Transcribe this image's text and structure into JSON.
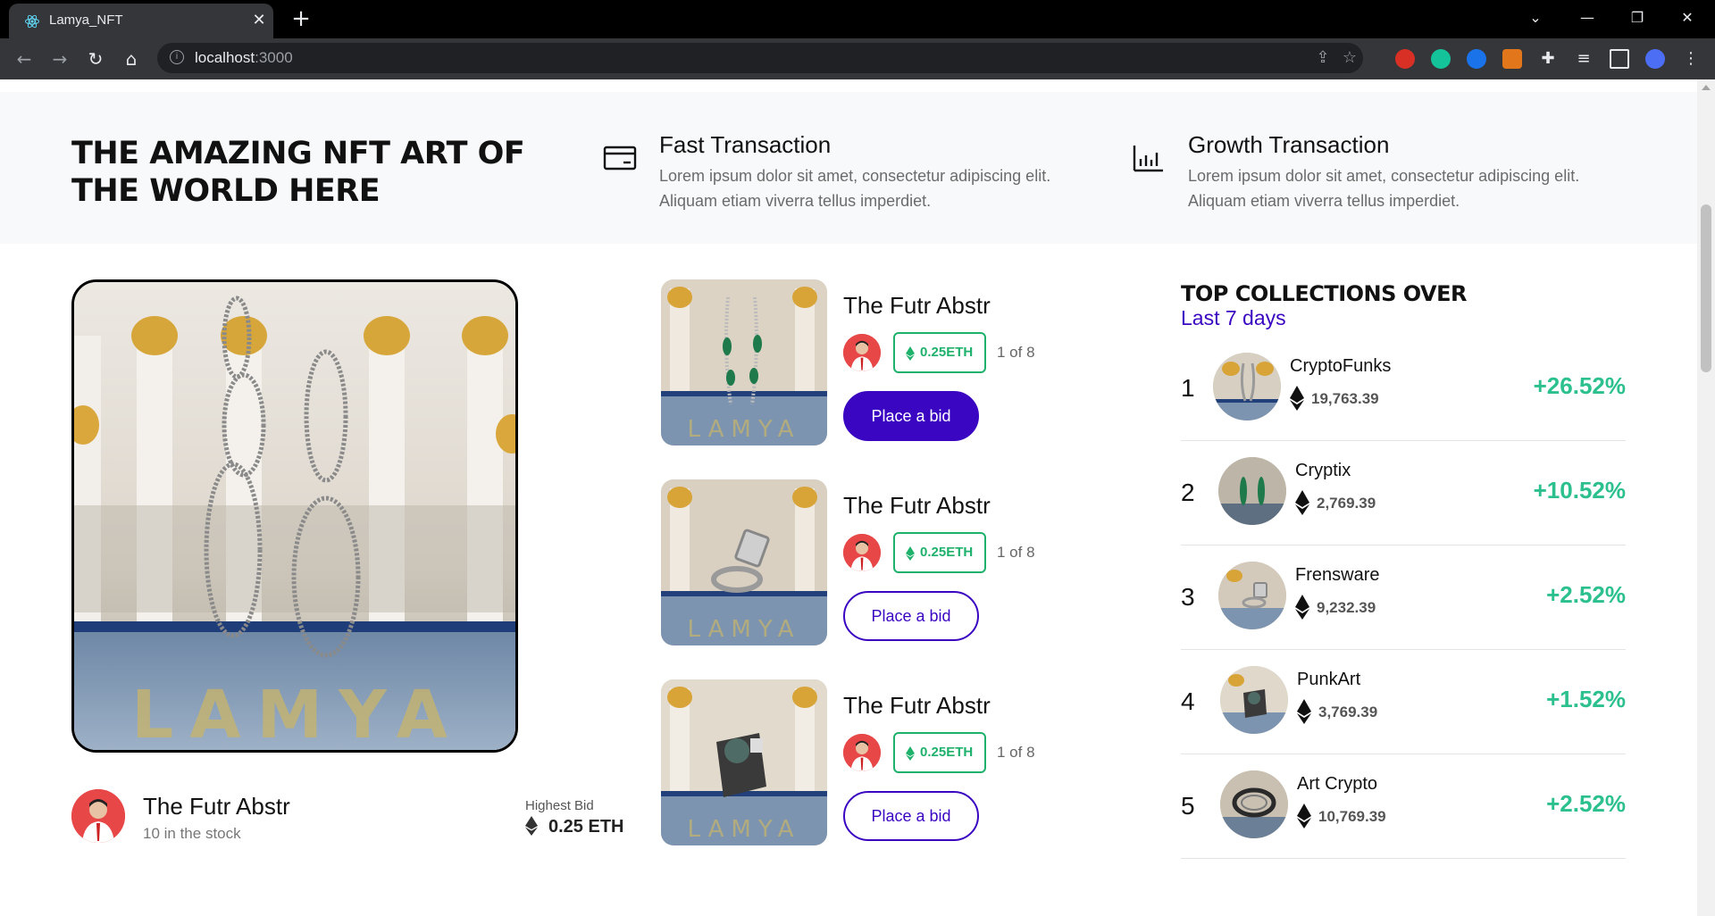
{
  "browser": {
    "tab_title": "Lamya_NFT",
    "url_host": "localhost",
    "url_port": ":3000"
  },
  "hero_section": {
    "headline": "THE AMAZING NFT ART OF THE WORLD HERE",
    "features": [
      {
        "icon": "card-icon",
        "title": "Fast Transaction",
        "description": "Lorem ipsum dolor sit amet, consectetur adipiscing elit. Aliquam etiam viverra tellus imperdiet."
      },
      {
        "icon": "bar-chart-icon",
        "title": "Growth Transaction",
        "description": "Lorem ipsum dolor sit amet, consectetur adipiscing elit. Aliquam etiam viverra tellus imperdiet."
      }
    ]
  },
  "featured": {
    "title": "The Futr Abstr",
    "stock": "10 in the stock",
    "bid_label": "Highest Bid",
    "bid_value": "0.25 ETH",
    "watermark": "LAMYA"
  },
  "listings": [
    {
      "title": "The Futr Abstr",
      "price": "0.25ETH",
      "edition": "1 of 8",
      "button": "Place a bid",
      "button_style": "solid"
    },
    {
      "title": "The Futr Abstr",
      "price": "0.25ETH",
      "edition": "1 of 8",
      "button": "Place a bid",
      "button_style": "outline"
    },
    {
      "title": "The Futr Abstr",
      "price": "0.25ETH",
      "edition": "1 of 8",
      "button": "Place a bid",
      "button_style": "outline"
    }
  ],
  "collections": {
    "title": "TOP COLLECTIONS OVER",
    "subtitle": "Last 7 days",
    "items": [
      {
        "rank": "1",
        "name": "CryptoFunks",
        "value": "19,763.39",
        "change": "+26.52%"
      },
      {
        "rank": "2",
        "name": "Cryptix",
        "value": "2,769.39",
        "change": "+10.52%"
      },
      {
        "rank": "3",
        "name": "Frensware",
        "value": "9,232.39",
        "change": "+2.52%"
      },
      {
        "rank": "4",
        "name": "PunkArt",
        "value": "3,769.39",
        "change": "+1.52%"
      },
      {
        "rank": "5",
        "name": "Art Crypto",
        "value": "10,769.39",
        "change": "+2.52%"
      }
    ]
  },
  "colors": {
    "accent_purple": "#3a06c2",
    "positive_green": "#2bc08d",
    "price_green": "#1eb16b"
  }
}
